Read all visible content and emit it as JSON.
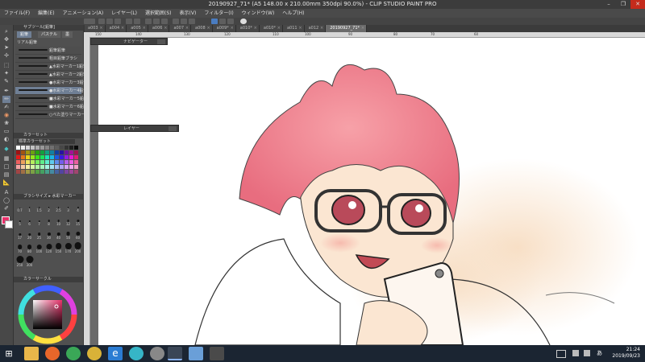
{
  "window": {
    "title": "20190927_71* (A5 148.00 x 210.00mm 350dpi 90.0%) - CLIP STUDIO PAINT PRO",
    "controls": [
      "–",
      "❐",
      "✕"
    ]
  },
  "menu": [
    "ファイル(F)",
    "編集(E)",
    "アニメーション(A)",
    "レイヤー(L)",
    "選択範囲(S)",
    "表示(V)",
    "フィルター(I)",
    "ウィンドウ(W)",
    "ヘルプ(H)"
  ],
  "tabs": [
    "a003",
    "a004",
    "a005",
    "a006",
    "a007",
    "a008",
    "a009*",
    "a010*",
    "a010*",
    "a011",
    "a012",
    "20190927_71*"
  ],
  "active_tab_index": 11,
  "ruler_ticks": [
    "150",
    "140",
    "130",
    "120",
    "110",
    "100",
    "90",
    "80",
    "70",
    "60"
  ],
  "panels": {
    "subtool": {
      "header": "サブツール[鉛筆]",
      "tabs": [
        "鉛筆",
        "パステル",
        "墨"
      ],
      "category": "リアル鉛筆",
      "brushes": [
        {
          "name": "鉛筆鉛筆",
          "selected": false
        },
        {
          "name": "粗目鉛筆ブラシ",
          "selected": false
        },
        {
          "name": "▲水彩マーカー1鉛筆",
          "selected": false
        },
        {
          "name": "▲水彩マーカー2鉛筆",
          "selected": false
        },
        {
          "name": "●水彩マーカー3鉛筆",
          "selected": false
        },
        {
          "name": "●水彩マーカー4鉛筆",
          "selected": true
        },
        {
          "name": "■水彩マーカー5鉛筆",
          "selected": false
        },
        {
          "name": "■水彩マーカー6鉛筆",
          "selected": false
        },
        {
          "name": "○べた塗りマーカー鉛筆",
          "selected": false
        }
      ]
    },
    "color_set": {
      "header": "カラーセット",
      "set_name": "標準カラーセット"
    },
    "brush_size": {
      "header": "ブラシサイズ",
      "sub": "水彩マーカー",
      "sizes": [
        "0.7",
        "1",
        "1.5",
        "2",
        "2.5",
        "3",
        "4",
        "5",
        "6",
        "7",
        "8",
        "10",
        "12",
        "15",
        "17",
        "20",
        "25",
        "30",
        "40",
        "50",
        "60",
        "70",
        "80",
        "100",
        "120",
        "150",
        "170",
        "200",
        "250",
        "300"
      ]
    },
    "color_wheel": {
      "header": "カラーサークル",
      "main_color": "#e8306a",
      "sub_color": "#ffffff"
    },
    "navigator": {
      "header": "ナビゲーター"
    },
    "layer": {
      "header": "レイヤー"
    }
  },
  "taskbar": {
    "time": "21:24",
    "date": "2019/09/23",
    "apps": [
      "start",
      "search",
      "task-view",
      "file-explorer",
      "firefox",
      "chrome",
      "folder",
      "ie",
      "chat",
      "app",
      "clip-studio",
      "photos",
      "tablet"
    ]
  }
}
